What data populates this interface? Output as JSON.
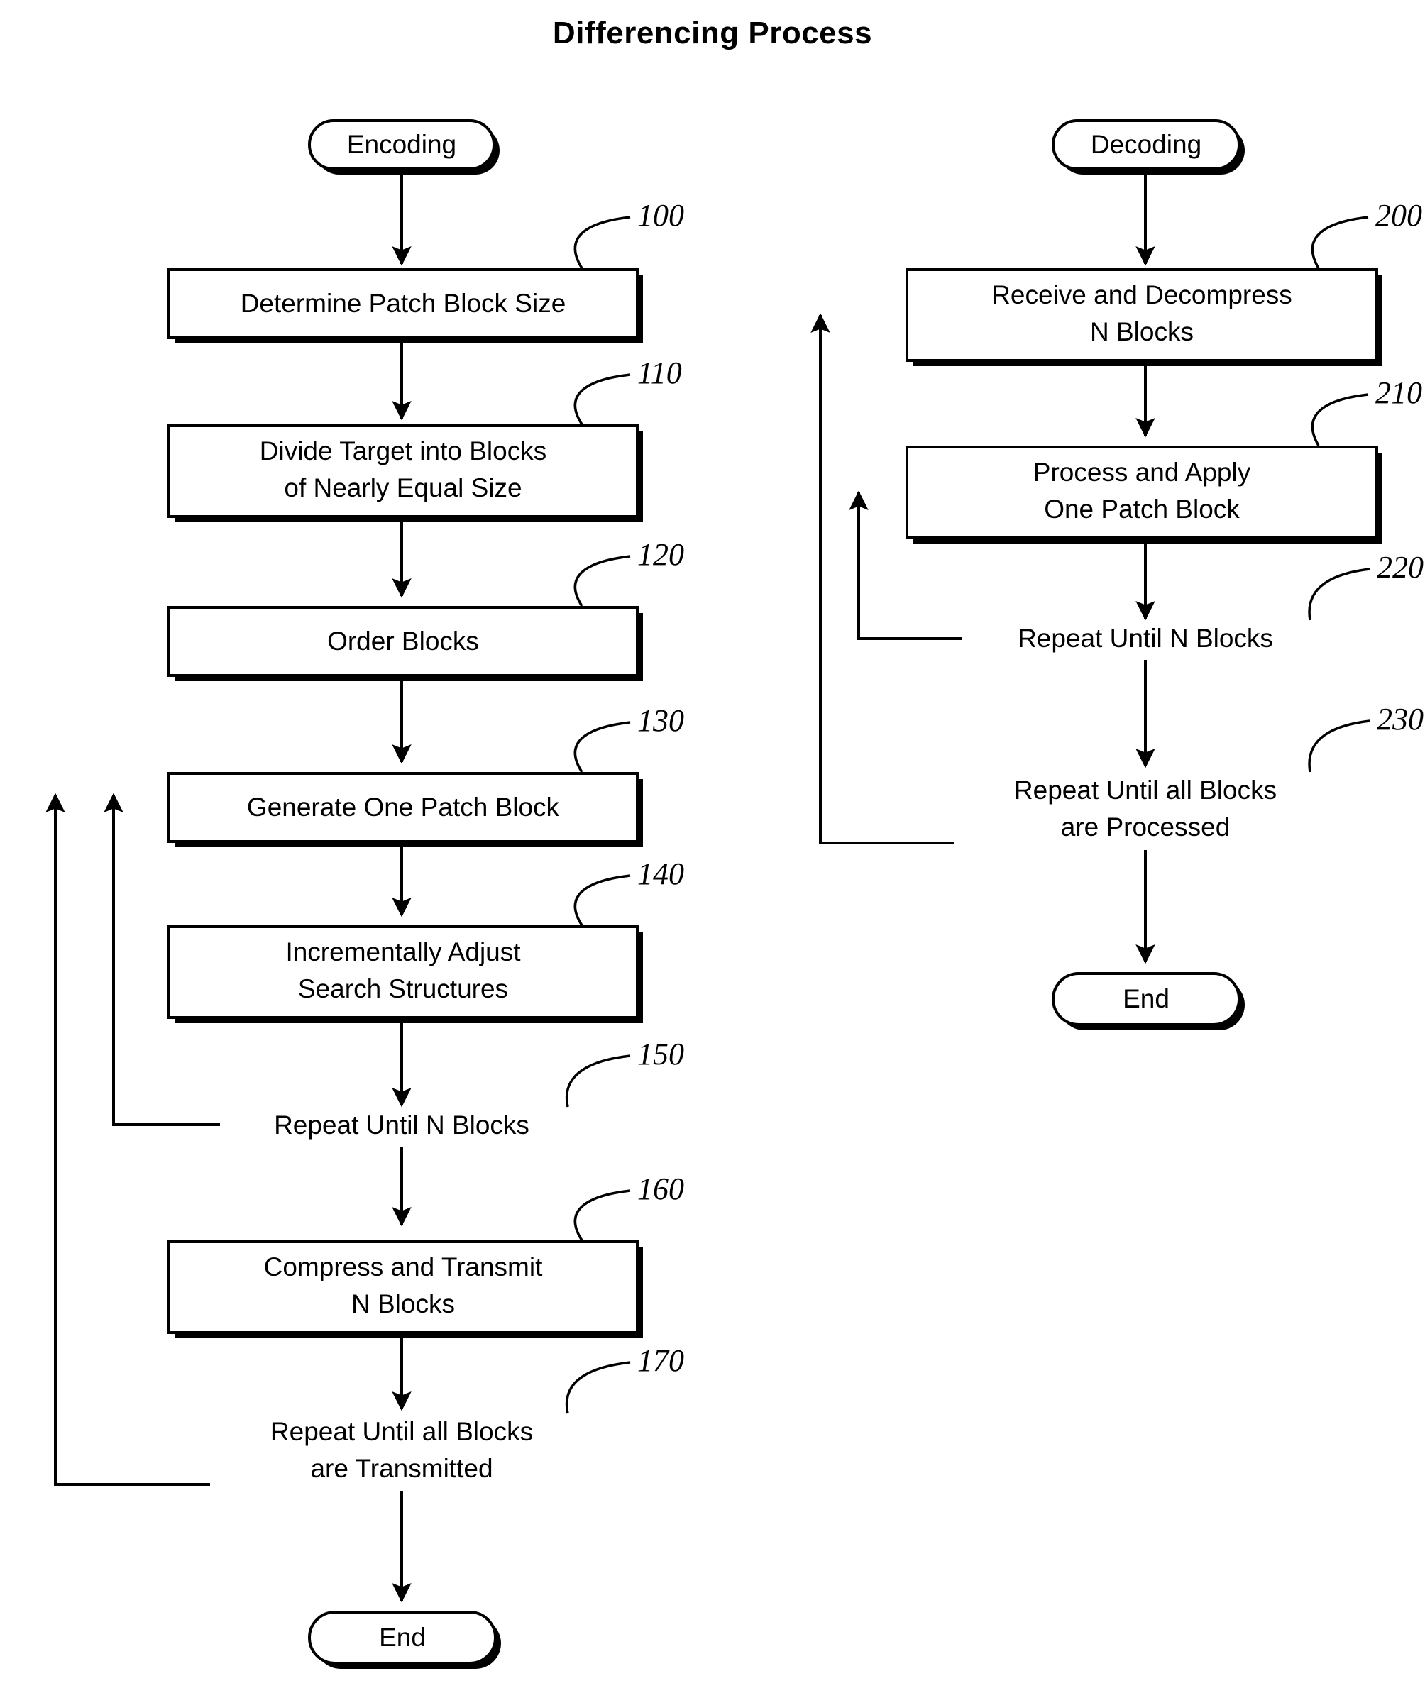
{
  "title": "Differencing Process",
  "colors": {
    "ink": "#000000",
    "paper": "#ffffff"
  },
  "chart_data": {
    "type": "diagram",
    "diagram_type": "flowchart",
    "title": "Differencing Process",
    "lanes": [
      {
        "id": "encoding",
        "start_label": "Encoding",
        "end_label": "End",
        "steps": [
          {
            "ref": "100",
            "label": "Determine Patch Block Size",
            "shape": "process"
          },
          {
            "ref": "110",
            "label": "Divide Target into Blocks\nof Nearly Equal Size",
            "shape": "process"
          },
          {
            "ref": "120",
            "label": "Order Blocks",
            "shape": "process"
          },
          {
            "ref": "130",
            "label": "Generate One Patch Block",
            "shape": "process"
          },
          {
            "ref": "140",
            "label": "Incrementally Adjust\nSearch Structures",
            "shape": "process"
          },
          {
            "ref": "150",
            "label": "Repeat Until N Blocks",
            "shape": "plain"
          },
          {
            "ref": "160",
            "label": "Compress and Transmit\nN Blocks",
            "shape": "process"
          },
          {
            "ref": "170",
            "label": "Repeat Until all Blocks\nare Transmitted",
            "shape": "plain"
          }
        ],
        "loops": [
          {
            "from": "150",
            "to": "130",
            "direction": "up-left"
          },
          {
            "from": "170",
            "to": "130",
            "direction": "up-left"
          }
        ]
      },
      {
        "id": "decoding",
        "start_label": "Decoding",
        "end_label": "End",
        "steps": [
          {
            "ref": "200",
            "label": "Receive and Decompress\nN Blocks",
            "shape": "process"
          },
          {
            "ref": "210",
            "label": "Process and Apply\nOne Patch Block",
            "shape": "process"
          },
          {
            "ref": "220",
            "label": "Repeat Until N Blocks",
            "shape": "plain"
          },
          {
            "ref": "230",
            "label": "Repeat Until all Blocks\nare Processed",
            "shape": "plain"
          }
        ],
        "loops": [
          {
            "from": "220",
            "to": "210",
            "direction": "up-left"
          },
          {
            "from": "230",
            "to": "200",
            "direction": "up-left"
          }
        ]
      }
    ]
  },
  "encoding": {
    "start": {
      "label": "Encoding"
    },
    "n100": {
      "ref": "100",
      "line1": "Determine Patch Block Size"
    },
    "n110": {
      "ref": "110",
      "line1": "Divide Target into Blocks",
      "line2": "of Nearly Equal Size"
    },
    "n120": {
      "ref": "120",
      "line1": "Order Blocks"
    },
    "n130": {
      "ref": "130",
      "line1": "Generate One Patch Block"
    },
    "n140": {
      "ref": "140",
      "line1": "Incrementally Adjust",
      "line2": "Search Structures"
    },
    "n150": {
      "ref": "150",
      "line1": "Repeat Until N Blocks"
    },
    "n160": {
      "ref": "160",
      "line1": "Compress and Transmit",
      "line2": "N Blocks"
    },
    "n170": {
      "ref": "170",
      "line1": "Repeat Until all Blocks",
      "line2": "are Transmitted"
    },
    "end": {
      "label": "End"
    }
  },
  "decoding": {
    "start": {
      "label": "Decoding"
    },
    "n200": {
      "ref": "200",
      "line1": "Receive and Decompress",
      "line2": "N Blocks"
    },
    "n210": {
      "ref": "210",
      "line1": "Process and Apply",
      "line2": "One Patch Block"
    },
    "n220": {
      "ref": "220",
      "line1": "Repeat Until N Blocks"
    },
    "n230": {
      "ref": "230",
      "line1": "Repeat Until all Blocks",
      "line2": "are Processed"
    },
    "end": {
      "label": "End"
    }
  }
}
